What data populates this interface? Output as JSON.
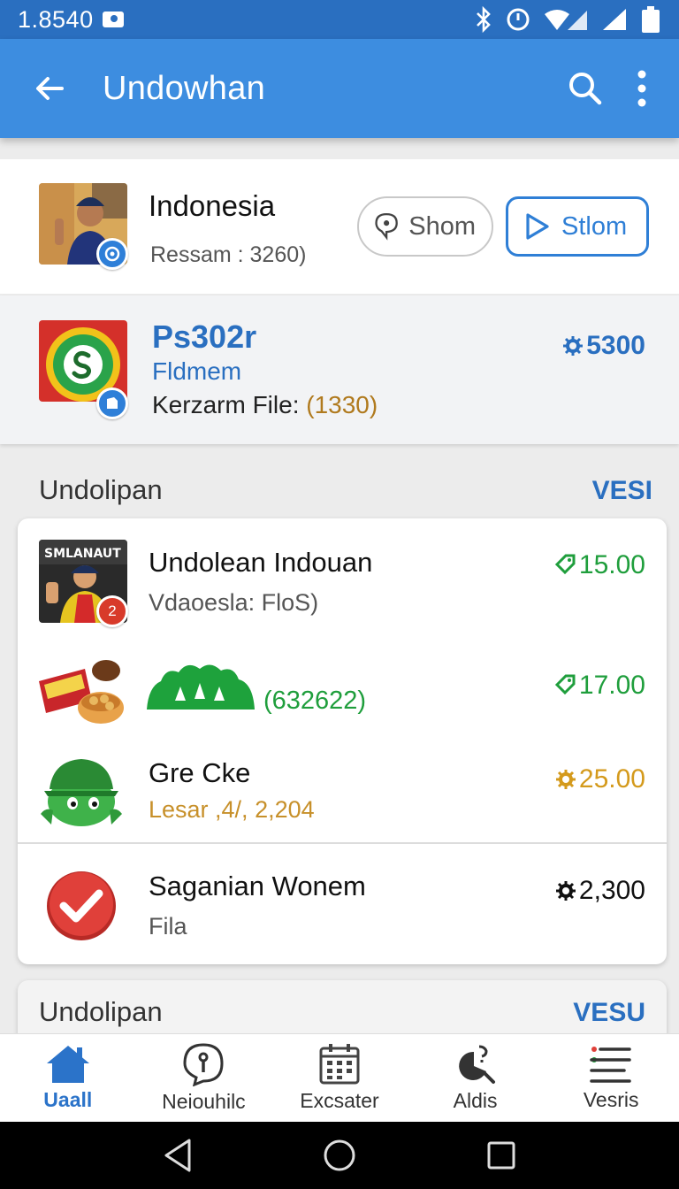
{
  "status_bar": {
    "time": "1.8540"
  },
  "app_bar": {
    "title": "Undowhan"
  },
  "top_card": {
    "title": "Indonesia",
    "subtitle": "Ressam : 3260)",
    "show_label": "Shom",
    "stream_label": "Stlom"
  },
  "featured": {
    "title": "Ps302r",
    "subtitle": "Fldmem",
    "meta_label": "Kerzarm File: ",
    "meta_count": "(1330)",
    "price": "5300"
  },
  "section1": {
    "heading": "Undolipan",
    "link": "VESI"
  },
  "list": [
    {
      "title": "Undolean Indouan",
      "subtitle": "Vdaoesla: FloS)",
      "price": "15.00",
      "badge": "2"
    },
    {
      "subtitle": "(632622)",
      "price": "17.00"
    },
    {
      "title": "Gre Cke",
      "subtitle": "Lesar ,4/, 2,204",
      "price": "25.00"
    },
    {
      "title": "Saganian Wonem",
      "subtitle": "Fila",
      "price": "2,300"
    }
  ],
  "section2": {
    "heading": "Undolipan",
    "link": "VESU"
  },
  "bottom_nav": [
    {
      "label": "Uaall",
      "icon": "home-icon"
    },
    {
      "label": "Neiouhilc",
      "icon": "info-bubble-icon"
    },
    {
      "label": "Excsater",
      "icon": "calendar-icon"
    },
    {
      "label": "Aldis",
      "icon": "pie-chart-icon"
    },
    {
      "label": "Vesris",
      "icon": "list-icon"
    }
  ],
  "colors": {
    "app_bar": "#3d8de0",
    "status_bar": "#2a6fc0",
    "accent_blue": "#2a6fc0",
    "price_green": "#1f9e3c",
    "price_gold": "#d49a1c",
    "price_orange": "#b07a1e"
  }
}
